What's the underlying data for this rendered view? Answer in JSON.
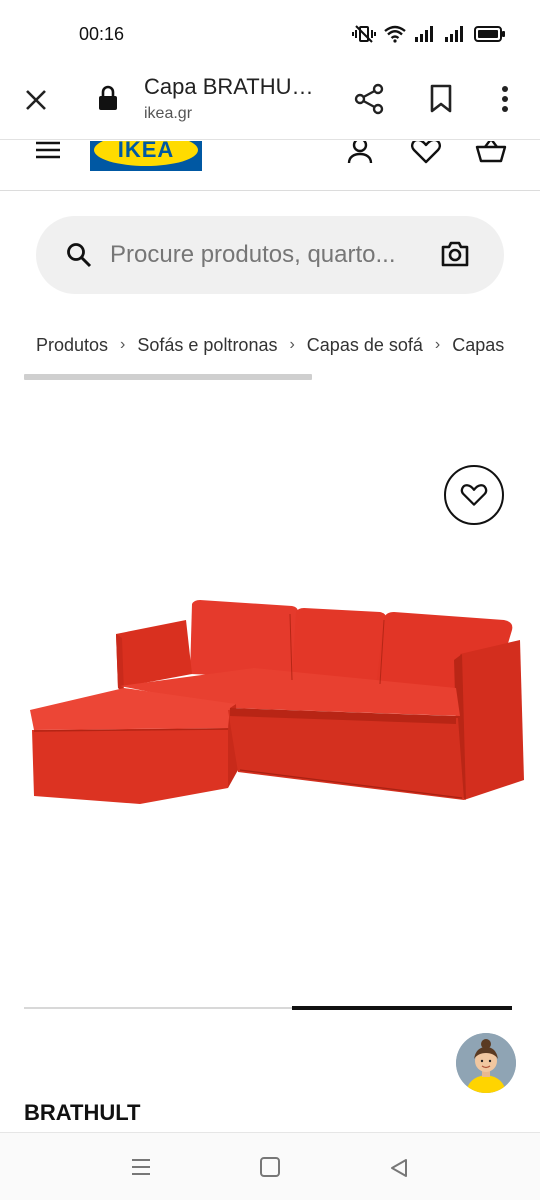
{
  "status_bar": {
    "time": "00:16",
    "icons": [
      "mute-vibrate-icon",
      "wifi-icon",
      "signal-icon",
      "signal-icon",
      "battery-icon"
    ]
  },
  "custom_tab": {
    "title": "Capa BRATHU…",
    "domain": "ikea.gr",
    "icons": [
      "close-icon",
      "lock-icon",
      "share-icon",
      "bookmark-icon",
      "more-vert-icon"
    ]
  },
  "header": {
    "logo_text": "IKEA",
    "icons": [
      "menu-icon",
      "profile-icon",
      "heart-icon",
      "cart-icon"
    ]
  },
  "search": {
    "placeholder": "Procure produtos, quarto..."
  },
  "breadcrumb": {
    "items": [
      "Produtos",
      "Sofás e poltronas",
      "Capas de sofá",
      "Capas"
    ],
    "separator": "›"
  },
  "gallery": {
    "image_alt": "red corner sofa",
    "slide_progress": {
      "start": 0.55,
      "end": 1.0
    }
  },
  "product": {
    "name": "BRATHULT"
  },
  "colors": {
    "ikea_blue": "#0058a3",
    "ikea_yellow": "#ffdb00",
    "sofa_red": "#e8382a"
  }
}
